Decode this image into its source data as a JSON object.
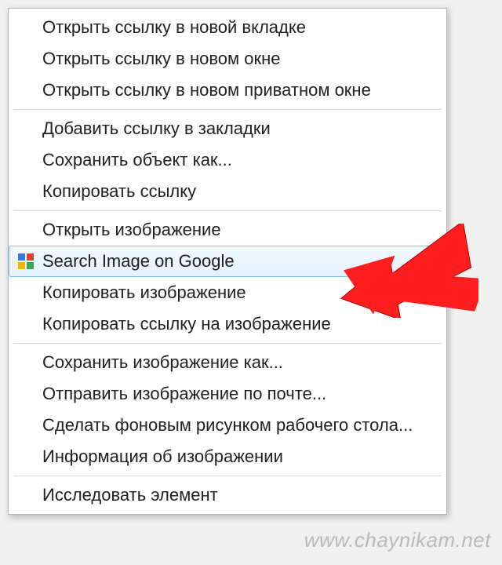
{
  "menu": {
    "groups": [
      [
        {
          "id": "open-link-new-tab",
          "label": "Открыть ссылку в новой вкладке",
          "icon": null,
          "highlight": false
        },
        {
          "id": "open-link-new-window",
          "label": "Открыть ссылку в новом окне",
          "icon": null,
          "highlight": false
        },
        {
          "id": "open-link-private",
          "label": "Открыть ссылку в новом приватном окне",
          "icon": null,
          "highlight": false
        }
      ],
      [
        {
          "id": "bookmark-link",
          "label": "Добавить ссылку в закладки",
          "icon": null,
          "highlight": false
        },
        {
          "id": "save-link-as",
          "label": "Сохранить объект как...",
          "icon": null,
          "highlight": false
        },
        {
          "id": "copy-link",
          "label": "Копировать ссылку",
          "icon": null,
          "highlight": false
        }
      ],
      [
        {
          "id": "open-image",
          "label": "Открыть изображение",
          "icon": null,
          "highlight": false
        },
        {
          "id": "search-image-google",
          "label": "Search Image on Google",
          "icon": "google",
          "highlight": true
        },
        {
          "id": "copy-image",
          "label": "Копировать изображение",
          "icon": null,
          "highlight": false
        },
        {
          "id": "copy-image-link",
          "label": "Копировать ссылку на изображение",
          "icon": null,
          "highlight": false
        }
      ],
      [
        {
          "id": "save-image-as",
          "label": "Сохранить изображение как...",
          "icon": null,
          "highlight": false
        },
        {
          "id": "email-image",
          "label": "Отправить изображение по почте...",
          "icon": null,
          "highlight": false
        },
        {
          "id": "set-as-wallpaper",
          "label": "Сделать фоновым рисунком рабочего стола...",
          "icon": null,
          "highlight": false
        },
        {
          "id": "image-info",
          "label": "Информация об изображении",
          "icon": null,
          "highlight": false
        }
      ],
      [
        {
          "id": "inspect-element",
          "label": "Исследовать элемент",
          "icon": null,
          "highlight": false
        }
      ]
    ]
  },
  "arrow": {
    "color": "#ff1e1e"
  },
  "watermark": {
    "text": "www.chaynikam.net"
  }
}
